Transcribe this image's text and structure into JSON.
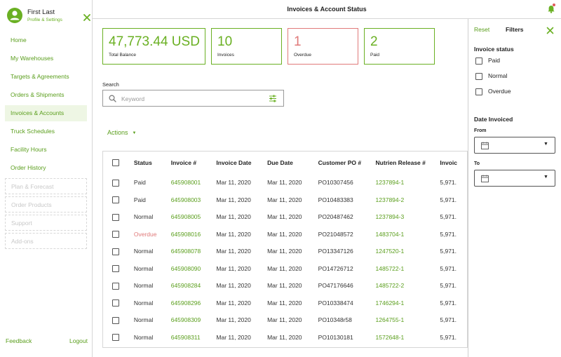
{
  "profile": {
    "name": "First Last",
    "subtitle": "Profile & Settings"
  },
  "sidebar": {
    "items": [
      {
        "label": "Home"
      },
      {
        "label": "My Warehouses"
      },
      {
        "label": "Targets & Agreements"
      },
      {
        "label": "Orders & Shipments"
      },
      {
        "label": "Invoices & Accounts"
      },
      {
        "label": "Truck Schedules"
      },
      {
        "label": "Facility Hours"
      },
      {
        "label": "Order History"
      },
      {
        "label": "Plan & Forecast"
      },
      {
        "label": "Order Products"
      },
      {
        "label": "Support"
      },
      {
        "label": "Add-ons"
      }
    ],
    "active": "Invoices & Accounts",
    "feedback": "Feedback",
    "logout": "Logout"
  },
  "header": {
    "title": "Invoices & Account Status"
  },
  "stats": {
    "balance": {
      "value": "47,773.44 USD",
      "label": "Total Balance"
    },
    "invoices": {
      "value": "10",
      "label": "Invoices"
    },
    "overdue": {
      "value": "1",
      "label": "Overdue"
    },
    "paid": {
      "value": "2",
      "label": "Paid"
    }
  },
  "search": {
    "label": "Search",
    "placeholder": "Keyword",
    "value": ""
  },
  "actions": {
    "label": "Actions"
  },
  "table": {
    "columns": [
      "Status",
      "Invoice #",
      "Invoice Date",
      "Due Date",
      "Customer PO #",
      "Nutrien Release #",
      "Invoic"
    ],
    "rows": [
      {
        "status": "Paid",
        "invoice": "645908001",
        "invoice_date": "Mar 11, 2020",
        "due_date": "Mar 11, 2020",
        "po": "PO10307456",
        "release": "1237894-1",
        "amount": "5,971."
      },
      {
        "status": "Paid",
        "invoice": "645908003",
        "invoice_date": "Mar 11, 2020",
        "due_date": "Mar 11, 2020",
        "po": "PO10483383",
        "release": "1237894-2",
        "amount": "5,971."
      },
      {
        "status": "Normal",
        "invoice": "645908005",
        "invoice_date": "Mar 11, 2020",
        "due_date": "Mar 11, 2020",
        "po": "PO20487462",
        "release": "1237894-3",
        "amount": "5,971."
      },
      {
        "status": "Overdue",
        "invoice": "645908016",
        "invoice_date": "Mar 11, 2020",
        "due_date": "Mar 11, 2020",
        "po": "PO21048572",
        "release": "1483704-1",
        "amount": "5,971."
      },
      {
        "status": "Normal",
        "invoice": "645908078",
        "invoice_date": "Mar 11, 2020",
        "due_date": "Mar 11, 2020",
        "po": "PO13347126",
        "release": "1247520-1",
        "amount": "5,971."
      },
      {
        "status": "Normal",
        "invoice": "645908090",
        "invoice_date": "Mar 11, 2020",
        "due_date": "Mar 11, 2020",
        "po": "PO14726712",
        "release": "1485722-1",
        "amount": "5,971."
      },
      {
        "status": "Normal",
        "invoice": "645908284",
        "invoice_date": "Mar 11, 2020",
        "due_date": "Mar 11, 2020",
        "po": "PO47176646",
        "release": "1485722-2",
        "amount": "5,971."
      },
      {
        "status": "Normal",
        "invoice": "645908296",
        "invoice_date": "Mar 11, 2020",
        "due_date": "Mar 11, 2020",
        "po": "PO10338474",
        "release": "1746294-1",
        "amount": "5,971."
      },
      {
        "status": "Normal",
        "invoice": "645908309",
        "invoice_date": "Mar 11, 2020",
        "due_date": "Mar 11, 2020",
        "po": "PO10348r58",
        "release": "1264755-1",
        "amount": "5,971."
      },
      {
        "status": "Normal",
        "invoice": "645908311",
        "invoice_date": "Mar 11, 2020",
        "due_date": "Mar 11, 2020",
        "po": "PO10130181",
        "release": "1572648-1",
        "amount": "5,971."
      }
    ]
  },
  "filters": {
    "reset": "Reset",
    "title": "Filters",
    "status_heading": "Invoice status",
    "status_options": [
      "Paid",
      "Normal",
      "Overdue"
    ],
    "date_heading": "Date Invoiced",
    "from_label": "From",
    "to_label": "To"
  },
  "colors": {
    "accent": "#6ab023",
    "link": "#5a9e1c",
    "overdue": "#e07a7a",
    "active_bg": "#eef6e4",
    "notify": "#e05a5a"
  },
  "icons": [
    "person-icon",
    "close-icon",
    "bell-icon",
    "search-icon",
    "filter-sliders-icon",
    "chevron-down-icon",
    "calendar-icon",
    "caret-down-icon"
  ]
}
